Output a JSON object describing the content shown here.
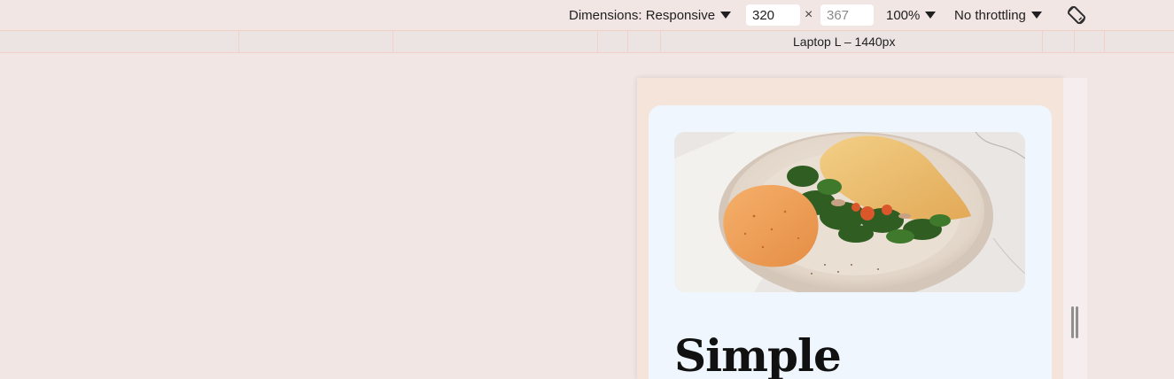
{
  "toolbar": {
    "dimensions_label": "Dimensions: Responsive",
    "width_value": "320",
    "height_placeholder": "367",
    "times_symbol": "×",
    "zoom_label": "100%",
    "throttling_label": "No throttling",
    "rotate_icon": "rotate-device-icon"
  },
  "media_query_bar": {
    "label": "Laptop L – 1440px"
  },
  "preview": {
    "image_icon": "crepe-dish-photo",
    "title": "Simple"
  },
  "colors": {
    "page_bg": "#f1e6e4",
    "mq_border": "#f2cfc4",
    "device_bg": "#f4e4d9",
    "card_bg": "#eff6fd"
  }
}
